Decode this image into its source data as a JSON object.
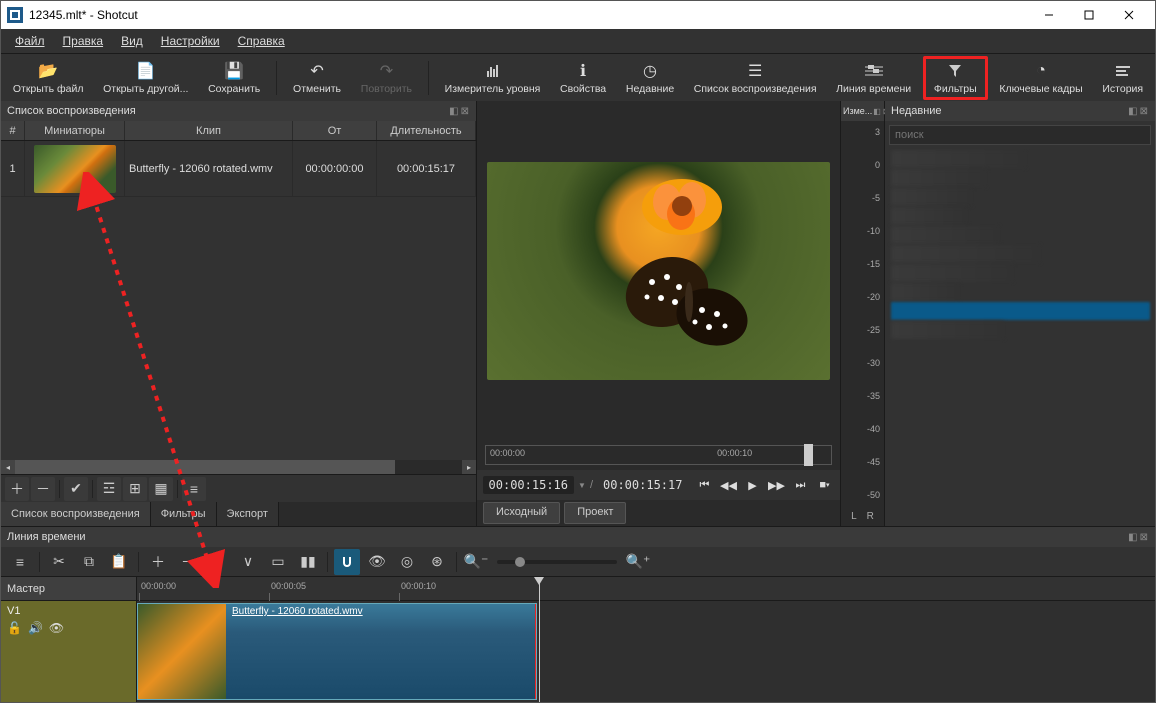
{
  "window": {
    "title": "12345.mlt* - Shotcut"
  },
  "menu": {
    "file": "Файл",
    "edit": "Правка",
    "view": "Вид",
    "settings": "Настройки",
    "help": "Справка"
  },
  "toolbar": {
    "open_file": "Открыть файл",
    "open_other": "Открыть другой...",
    "save": "Сохранить",
    "undo": "Отменить",
    "redo": "Повторить",
    "peak_meter": "Измеритель уровня",
    "properties": "Свойства",
    "recent": "Недавние",
    "playlist": "Список воспроизведения",
    "timeline": "Линия времени",
    "filters": "Фильтры",
    "keyframes": "Ключевые кадры",
    "history": "История"
  },
  "playlist": {
    "title": "Список воспроизведения",
    "cols": {
      "num": "#",
      "thumb": "Миниатюры",
      "clip": "Клип",
      "in": "От",
      "duration": "Длительность"
    },
    "rows": [
      {
        "num": "1",
        "clip": "Butterfly - 12060 rotated.wmv",
        "in": "00:00:00:00",
        "duration": "00:00:15:17"
      }
    ],
    "tabs": {
      "playlist": "Список воспроизведения",
      "filters": "Фильтры",
      "export": "Экспорт"
    }
  },
  "preview": {
    "scrub": {
      "t0": "00:00:00",
      "t1": "00:00:10"
    },
    "tc_cur": "00:00:15:16",
    "tc_total": "00:00:15:17",
    "tabs": {
      "source": "Исходный",
      "project": "Проект"
    }
  },
  "meters": {
    "hdr": "Изме...",
    "vals": [
      "3",
      "0",
      "-5",
      "-10",
      "-15",
      "-20",
      "-25",
      "-30",
      "-35",
      "-40",
      "-45",
      "-50"
    ],
    "l": "L",
    "r": "R"
  },
  "recent": {
    "title": "Недавние",
    "search": "поиск"
  },
  "timeline": {
    "title": "Линия времени",
    "master": "Мастер",
    "track": "V1",
    "ruler": [
      "00:00:00",
      "00:00:05",
      "00:00:10"
    ],
    "clip": "Butterfly - 12060 rotated.wmv"
  }
}
